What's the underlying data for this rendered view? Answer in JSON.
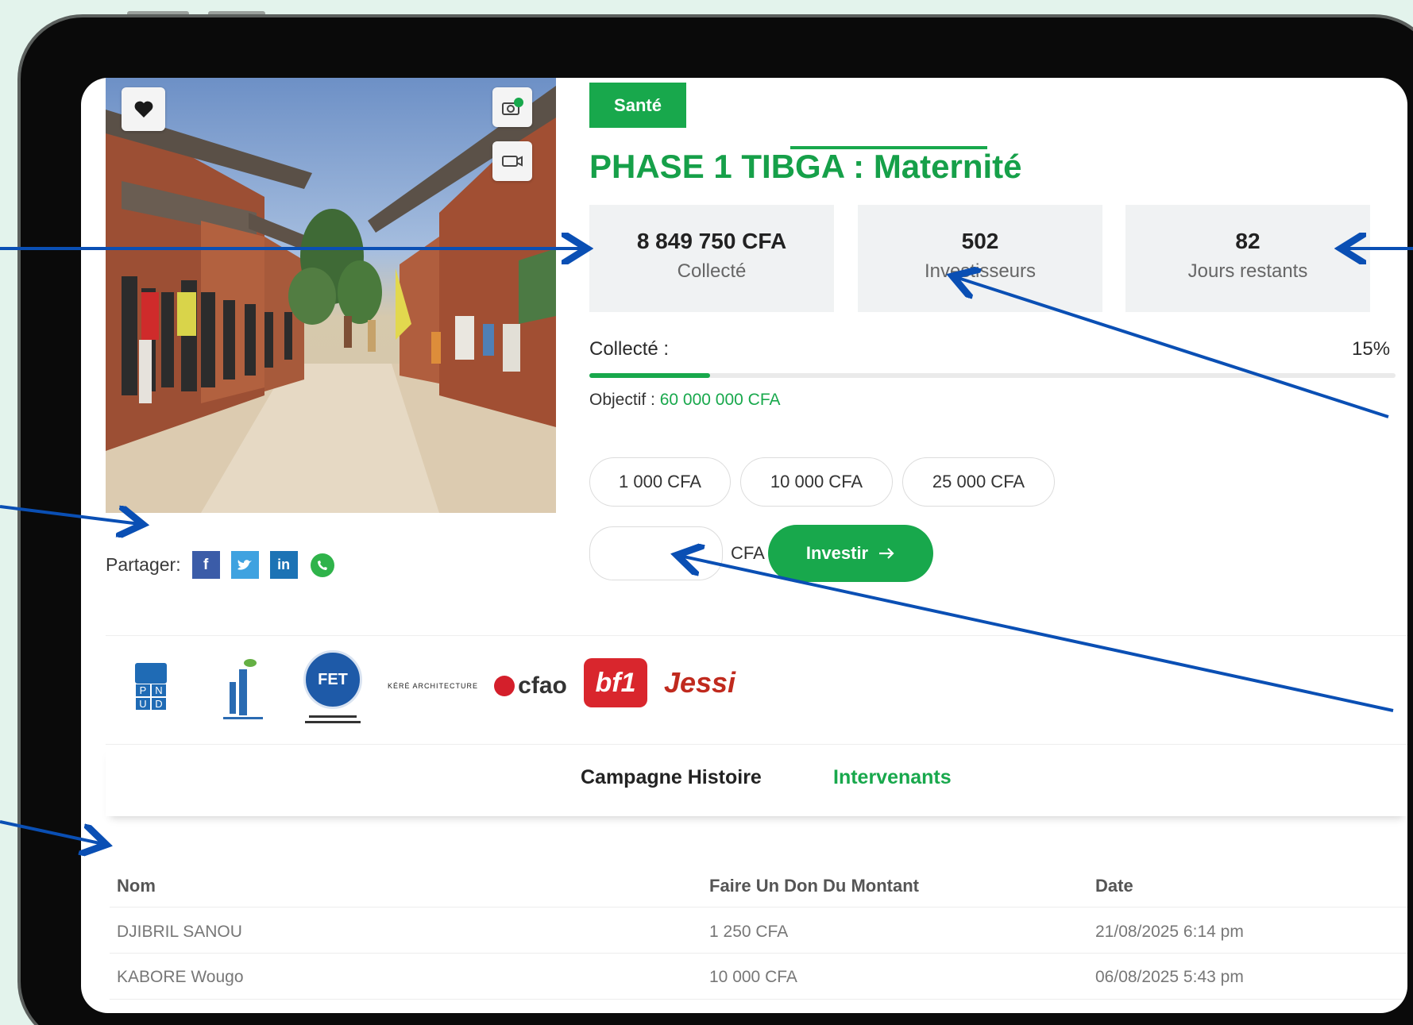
{
  "campaign": {
    "category_tag": "Santé",
    "title": "PHASE 1 TIBGA : Maternité"
  },
  "stats": [
    {
      "value": "8 849 750 CFA",
      "label": "Collecté"
    },
    {
      "value": "502",
      "label": "Investisseurs"
    },
    {
      "value": "82",
      "label": "Jours restants"
    }
  ],
  "progress": {
    "label": "Collecté :",
    "percent_text": "15%",
    "percent": 15,
    "objective_label": "Objectif :",
    "objective_value": "60 000 000 CFA"
  },
  "amount_options": [
    "1 000 CFA",
    "10 000 CFA",
    "25 000 CFA"
  ],
  "invest_form": {
    "input_value": "",
    "currency_label": "CFA",
    "button_label": "Investir",
    "button_icon": "arrow-right-icon"
  },
  "share": {
    "label": "Partager:",
    "networks": [
      "facebook",
      "twitter",
      "linkedin",
      "whatsapp"
    ]
  },
  "partners": {
    "pnud": [
      "P",
      "N",
      "U",
      "D"
    ],
    "fet": "FET",
    "kere": "KÉRÉ ARCHITECTURE",
    "cfao": "cfao",
    "bf1": "bf1",
    "jessi": "Jessi"
  },
  "tabs": [
    {
      "label": "Campagne Histoire",
      "active": false
    },
    {
      "label": "Intervenants",
      "active": true
    }
  ],
  "table": {
    "headers": [
      "Nom",
      "Faire Un Don Du Montant",
      "Date"
    ],
    "rows": [
      [
        "DJIBRIL SANOU",
        "1 250 CFA",
        "21/08/2025 6:14 pm"
      ],
      [
        "KABORE Wougo",
        "10 000 CFA",
        "06/08/2025 5:43 pm"
      ]
    ]
  },
  "colors": {
    "brand_green": "#18a84c",
    "annotation_blue": "#0a4fb4",
    "background": "#e3f3ec",
    "device_frame": "#0a0a0a"
  }
}
